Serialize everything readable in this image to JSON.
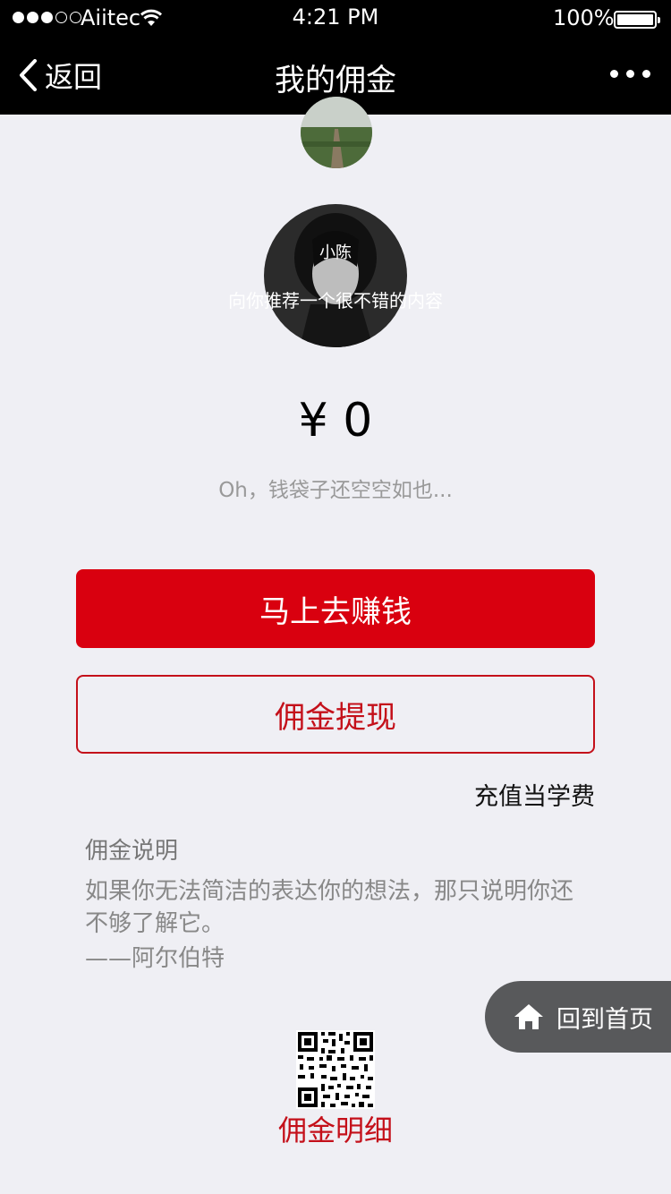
{
  "status_bar": {
    "carrier": "Aiitec",
    "time": "4:21 PM",
    "battery": "100%"
  },
  "nav": {
    "back_label": "返回",
    "title": "我的佣金"
  },
  "recommend": {
    "name": "小陈",
    "text": "向你推荐一个很不错的内容"
  },
  "wallet": {
    "amount": "¥ 0",
    "hint": "Oh，钱袋子还空空如也..."
  },
  "actions": {
    "earn_label": "马上去赚钱",
    "withdraw_label": "佣金提现",
    "recharge_link": "充值当学费"
  },
  "description": {
    "title": "佣金说明",
    "body": "如果你无法简洁的表达你的想法，那只说明你还不够了解它。",
    "signature": "——阿尔伯特"
  },
  "home_button": {
    "label": "回到首页"
  },
  "footer": {
    "detail_label": "佣金明细"
  },
  "colors": {
    "primary_red": "#d9000f",
    "outline_red": "#c4101a",
    "background": "#efeff4",
    "nav_black": "#000000"
  }
}
